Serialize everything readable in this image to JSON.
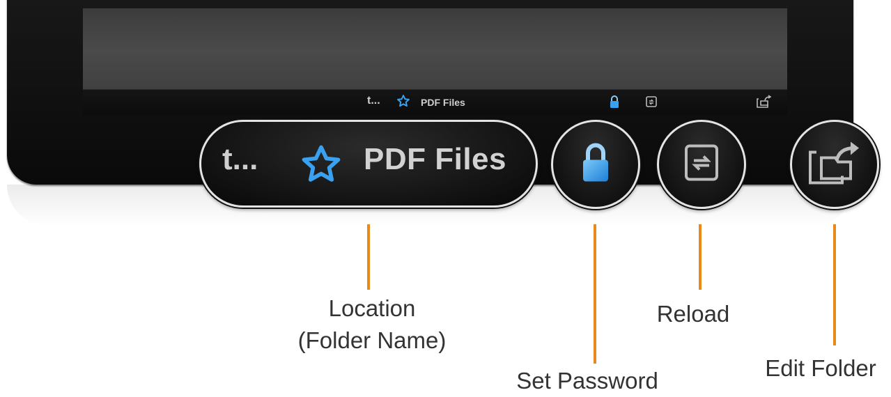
{
  "screen_toolbar": {
    "up_label": "t...",
    "title": "PDF Files"
  },
  "location_pill": {
    "up_label": "t...",
    "title": "PDF Files"
  },
  "callouts": {
    "location": "Location",
    "location_sub": "(Folder Name)",
    "set_password": "Set Password",
    "reload": "Reload",
    "edit_folder": "Edit Folder"
  },
  "icons": {
    "star": "star-icon",
    "lock": "lock-icon",
    "reload": "reload-icon",
    "edit": "edit-folder-icon",
    "up": "up-arrow-icon"
  },
  "colors": {
    "accent_blue": "#3aa0f0",
    "callout_orange": "#e8891c",
    "label_gray": "#333333"
  }
}
